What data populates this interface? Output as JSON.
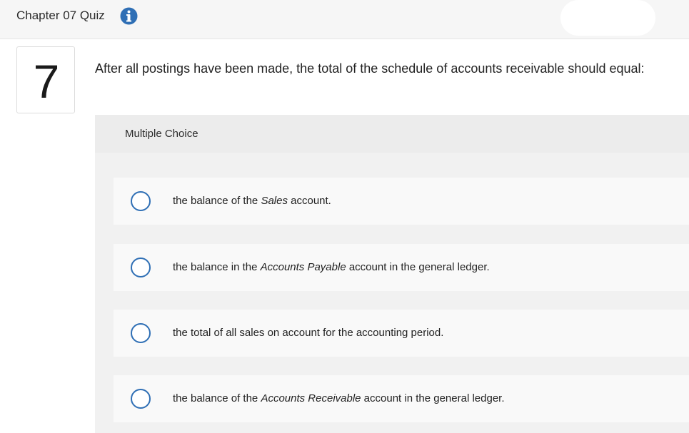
{
  "header": {
    "title": "Chapter 07 Quiz",
    "info_icon": "info-icon",
    "accent_color": "#2f6fb5"
  },
  "question": {
    "number": "7",
    "prompt": "After all postings have been made, the total of the schedule of accounts receivable should equal:"
  },
  "choices": {
    "type_label": "Multiple Choice",
    "options": [
      {
        "before": "the balance of the ",
        "italic": "Sales",
        "after": " account."
      },
      {
        "before": "the balance in the ",
        "italic": "Accounts Payable",
        "after": " account in the general ledger."
      },
      {
        "before": "the total of all sales on account for the accounting period.",
        "italic": "",
        "after": ""
      },
      {
        "before": "the balance of the ",
        "italic": "Accounts Receivable",
        "after": " account in the general ledger."
      }
    ]
  }
}
